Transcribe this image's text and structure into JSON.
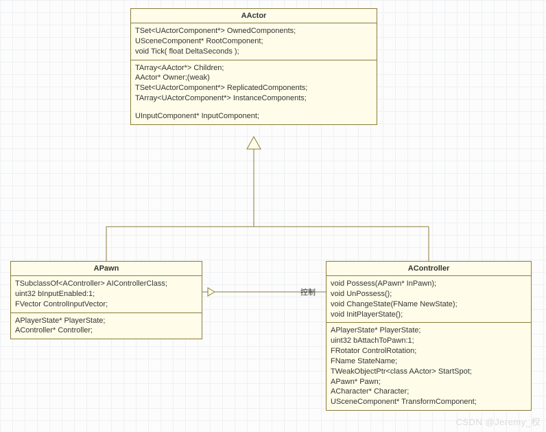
{
  "classes": {
    "aactor": {
      "name": "AActor",
      "section1": [
        "TSet<UActorComponent*> OwnedComponents;",
        "USceneComponent* RootComponent;",
        "void Tick( float DeltaSeconds );"
      ],
      "section2": [
        "TArray<AActor*> Children;",
        "AActor* Owner;(weak)",
        "TSet<UActorComponent*> ReplicatedComponents;",
        "TArray<UActorComponent*> InstanceComponents;",
        "",
        "UInputComponent* InputComponent;"
      ]
    },
    "apawn": {
      "name": "APawn",
      "section1": [
        "TSubclassOf<AController> AIControllerClass;",
        "uint32 bInputEnabled:1;",
        "FVector ControlInputVector;"
      ],
      "section2": [
        "APlayerState* PlayerState;",
        "AController* Controller;"
      ]
    },
    "acontroller": {
      "name": "AController",
      "section1": [
        "void Possess(APawn* InPawn);",
        "void UnPossess();",
        "void ChangeState(FName NewState);",
        "void InitPlayerState();"
      ],
      "section2": [
        "APlayerState* PlayerState;",
        "uint32 bAttachToPawn:1;",
        "FRotator ControlRotation;",
        "FName StateName;",
        "TWeakObjectPtr<class AActor> StartSpot;",
        "APawn* Pawn;",
        "ACharacter* Character;",
        "USceneComponent* TransformComponent;"
      ]
    }
  },
  "labels": {
    "control": "控制"
  },
  "watermark": "CSDN @Jeremy_权"
}
